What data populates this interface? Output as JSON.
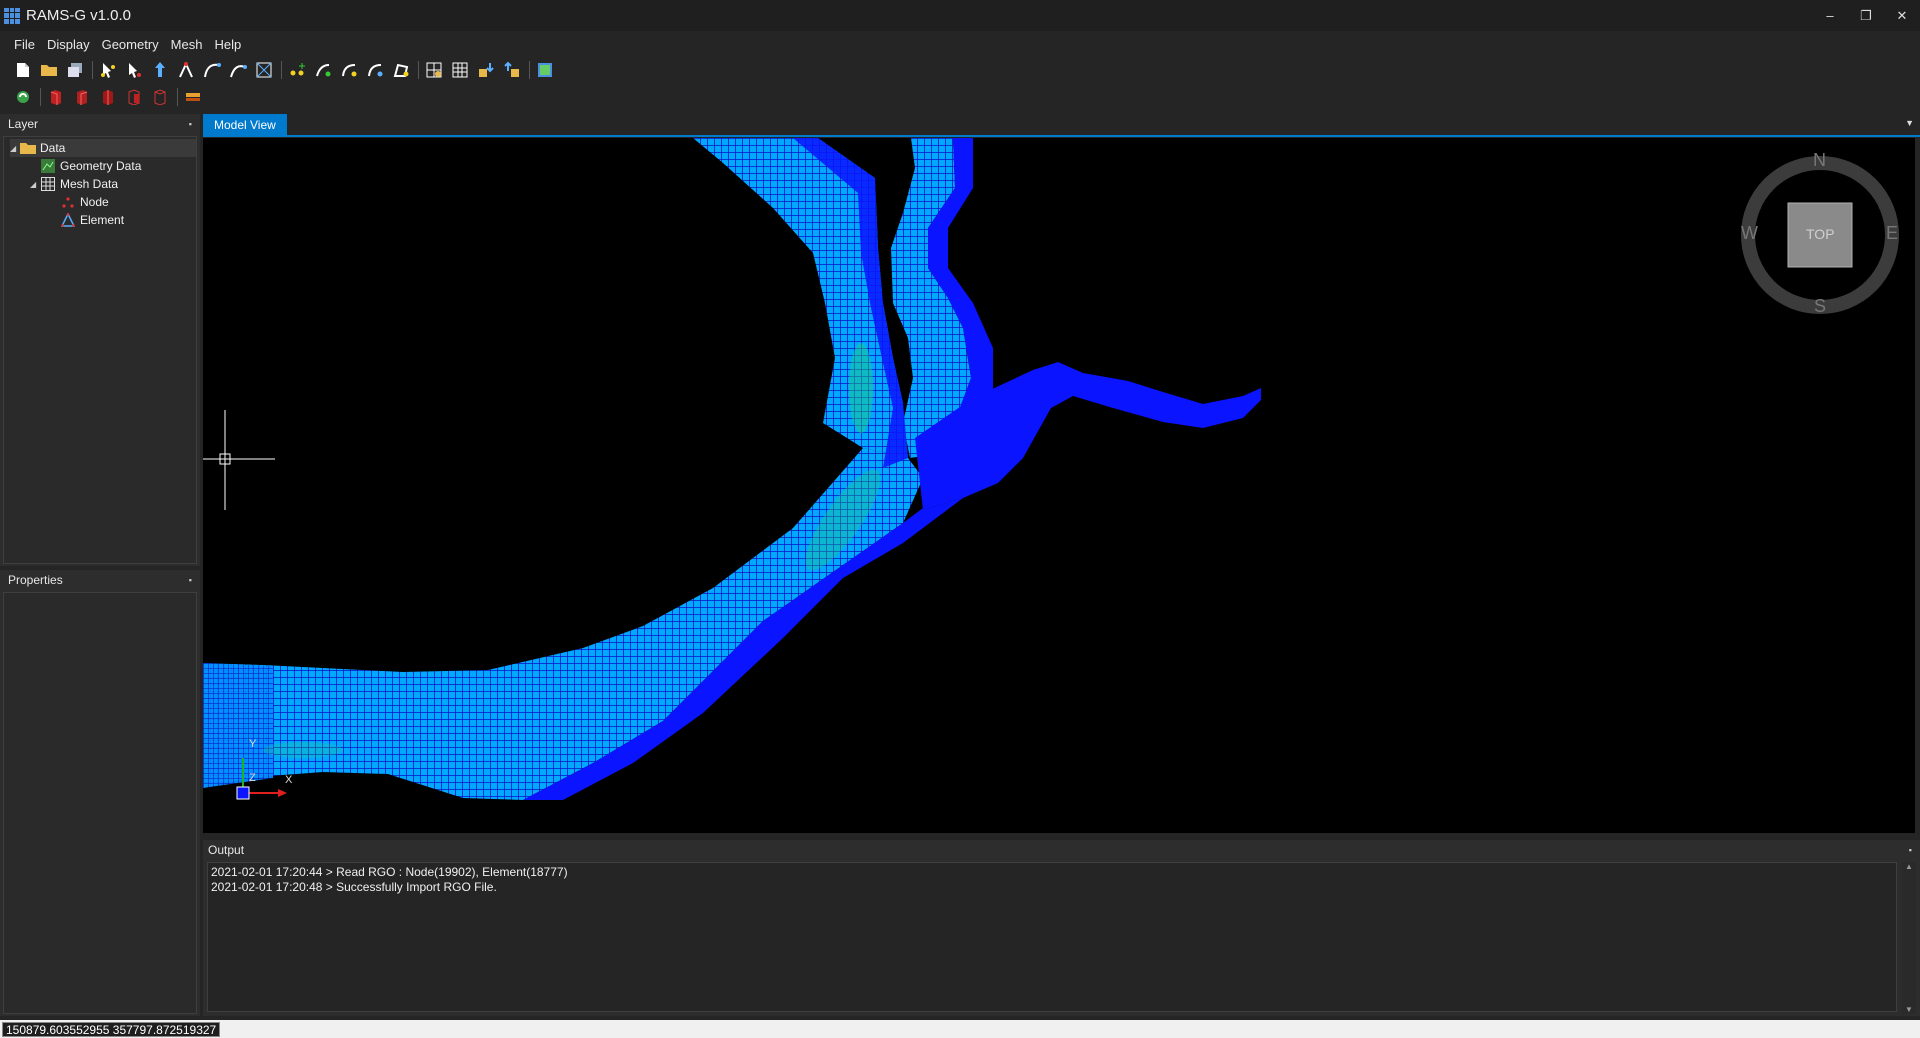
{
  "app": {
    "title": "RAMS-G v1.0.0",
    "window_controls": {
      "minimize": "–",
      "restore": "❐",
      "close": "✕"
    }
  },
  "menu": [
    "File",
    "Display",
    "Geometry",
    "Mesh",
    "Help"
  ],
  "layer_panel": {
    "title": "Layer",
    "pin": "📌",
    "tree": [
      {
        "label": "Data",
        "icon": "folder-icon"
      },
      {
        "label": "Geometry Data",
        "icon": "geometry-icon"
      },
      {
        "label": "Mesh Data",
        "icon": "mesh-icon"
      },
      {
        "label": "Node",
        "icon": "node-icon"
      },
      {
        "label": "Element",
        "icon": "element-icon"
      }
    ]
  },
  "properties_panel": {
    "title": "Properties"
  },
  "model_view": {
    "tab_label": "Model View",
    "compass": {
      "n": "N",
      "s": "S",
      "e": "E",
      "w": "W",
      "cube": "TOP"
    },
    "axes": {
      "x": "X",
      "y": "Y",
      "z": "Z"
    },
    "colors": {
      "mesh_low": "#0a14ff",
      "mesh_mid": "#00b4ff",
      "mesh_high": "#22d27a",
      "background": "#000000"
    }
  },
  "output_panel": {
    "title": "Output",
    "lines": [
      "2021-02-01 17:20:44 > Read RGO : Node(19902), Element(18777)",
      "2021-02-01 17:20:48 > Successfully Import RGO File."
    ]
  },
  "status": {
    "coordinates": "150879.603552955 357797.872519327"
  }
}
